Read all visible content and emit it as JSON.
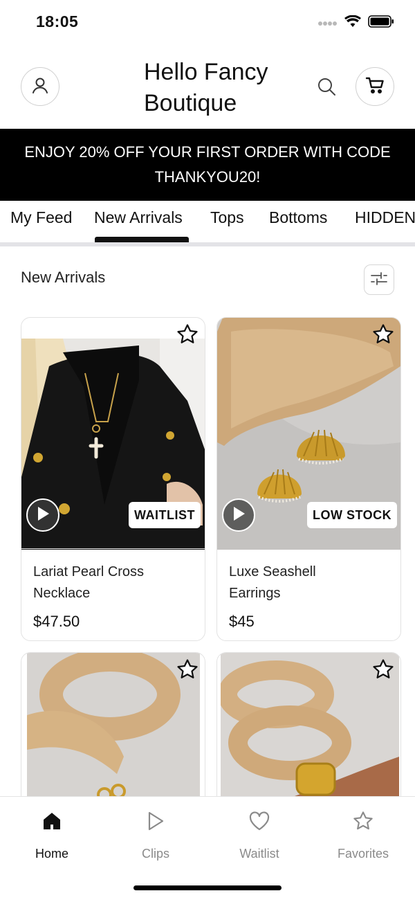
{
  "status_bar": {
    "time": "18:05"
  },
  "header": {
    "title_line1": "Hello Fancy",
    "title_line2": "Boutique",
    "profile_icon": "user-icon",
    "search_icon": "search-icon",
    "cart_icon": "cart-icon"
  },
  "promo": {
    "text": "ENJOY 20% OFF YOUR FIRST ORDER WITH CODE THANKYOU20!"
  },
  "tabs": [
    {
      "label": "My Feed",
      "active": false
    },
    {
      "label": "New Arrivals",
      "active": true
    },
    {
      "label": "Tops",
      "active": false
    },
    {
      "label": "Bottoms",
      "active": false
    },
    {
      "label": "HIDDEN",
      "active": false
    }
  ],
  "section": {
    "title": "New Arrivals",
    "filter_icon": "filter-icon"
  },
  "products": [
    {
      "name_line1": "Lariat Pearl Cross",
      "name_line2": "Necklace",
      "price": "$47.50",
      "badge": "WAITLIST"
    },
    {
      "name_line1": "Luxe Seashell",
      "name_line2": "Earrings",
      "price": "$45",
      "badge": "LOW STOCK"
    },
    {
      "name_line1": "",
      "name_line2": "",
      "price": "",
      "badge": ""
    },
    {
      "name_line1": "",
      "name_line2": "",
      "price": "",
      "badge": ""
    }
  ],
  "bottom_nav": [
    {
      "label": "Home",
      "icon": "home-icon",
      "active": true
    },
    {
      "label": "Clips",
      "icon": "play-icon",
      "active": false
    },
    {
      "label": "Waitlist",
      "icon": "heart-icon",
      "active": false
    },
    {
      "label": "Favorites",
      "icon": "star-icon",
      "active": false
    }
  ],
  "colors": {
    "accent": "#000000",
    "inactive_nav": "#8a8a8a",
    "divider": "#e3e3e7"
  }
}
